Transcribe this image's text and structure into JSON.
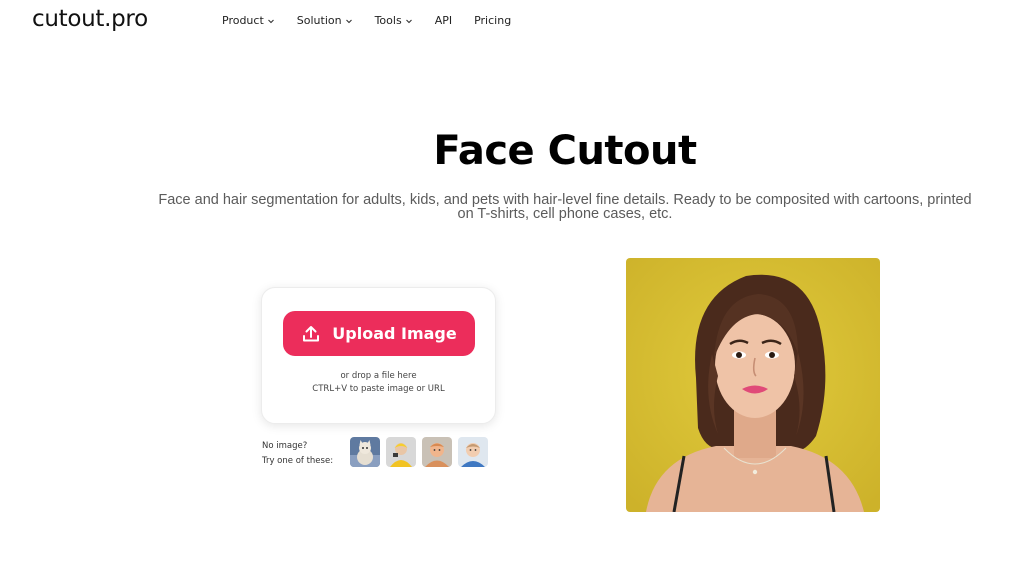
{
  "brand": {
    "logo_text": "cutout.pro"
  },
  "nav": {
    "items": [
      {
        "label": "Product",
        "has_dropdown": true
      },
      {
        "label": "Solution",
        "has_dropdown": true
      },
      {
        "label": "Tools",
        "has_dropdown": true
      },
      {
        "label": "API",
        "has_dropdown": false
      },
      {
        "label": "Pricing",
        "has_dropdown": false
      }
    ]
  },
  "hero": {
    "title": "Face Cutout",
    "subtitle": "Face and hair segmentation for adults, kids, and pets with hair-level fine details. Ready to be composited with cartoons, printed on T-shirts, cell phone cases, etc."
  },
  "upload": {
    "button_label": "Upload Image",
    "button_icon": "upload-icon",
    "drop_line1": "or drop a file here",
    "drop_line2": "CTRL+V to paste image or URL"
  },
  "samples": {
    "label_line1": "No image?",
    "label_line2": "Try one of these:",
    "items": [
      {
        "name": "sample-cat"
      },
      {
        "name": "sample-child-yellow"
      },
      {
        "name": "sample-baby-tan"
      },
      {
        "name": "sample-baby-blue"
      }
    ]
  },
  "preview": {
    "subject": "woman portrait on yellow background"
  },
  "colors": {
    "accent": "#ec2d5b",
    "preview_background": "#d9c032"
  }
}
